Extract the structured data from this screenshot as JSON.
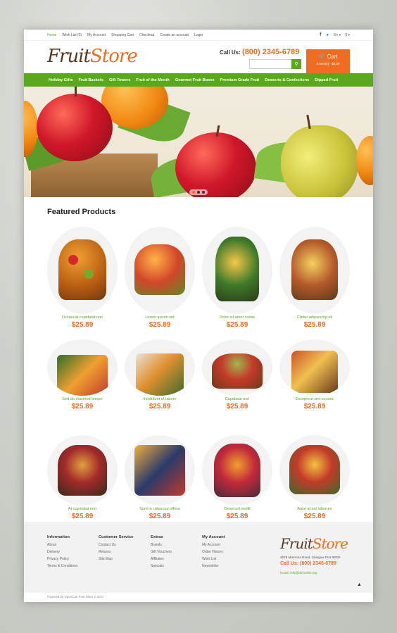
{
  "topbar": {
    "links": [
      "Home",
      "Wish List (0)",
      "My Account",
      "Shopping Cart",
      "Checkout",
      "Create an account",
      "Login"
    ],
    "language": "En",
    "currency": "$"
  },
  "header": {
    "logo_part1": "Fruit",
    "logo_part2": "Store",
    "call_label": "Call Us:",
    "phone": "(800) 2345-6789",
    "cart_label": "Cart",
    "cart_summary": "0 item(s) - $0.00"
  },
  "nav": {
    "items": [
      "Holiday Gifts",
      "Fruit Baskets",
      "Gift Towers",
      "Fruit of the Month",
      "Gourmet Fruit Boxes",
      "Premium Grade Fruit",
      "Desserts & Confections",
      "Dipped Fruit"
    ]
  },
  "featured": {
    "title": "Featured Products",
    "products": [
      {
        "name": "Occaecat cupidatat non",
        "price": "$25.89"
      },
      {
        "name": "Lorem ipsum set",
        "price": "$25.89"
      },
      {
        "name": "Dolor sit amet conse",
        "price": "$25.89"
      },
      {
        "name": "Ctetur adipisicing eli",
        "price": "$25.89"
      },
      {
        "name": "Sed do eiusmod tempo",
        "price": "$25.89"
      },
      {
        "name": "Incididunt ut labore",
        "price": "$25.89"
      },
      {
        "name": "Cupidatat non",
        "price": "$25.89"
      },
      {
        "name": "Excepteur sint occaec",
        "price": "$25.89"
      },
      {
        "name": "At cupidatat non",
        "price": "$25.89"
      },
      {
        "name": "Sunt in culpa qui officia",
        "price": "$25.89"
      },
      {
        "name": "Deserunt mollit",
        "price": "$25.89"
      },
      {
        "name": "Anim id est laborum",
        "price": "$25.89"
      }
    ]
  },
  "footer": {
    "columns": [
      {
        "title": "Information",
        "links": [
          "About",
          "Delivery",
          "Privacy Policy",
          "Terms & Conditions"
        ]
      },
      {
        "title": "Customer Service",
        "links": [
          "Contact Us",
          "Returns",
          "Site Map"
        ]
      },
      {
        "title": "Extras",
        "links": [
          "Brands",
          "Gift Vouchers",
          "Affiliates",
          "Specials"
        ]
      },
      {
        "title": "My Account",
        "links": [
          "My Account",
          "Order History",
          "Wish List",
          "Newsletter"
        ]
      }
    ],
    "logo_part1": "Fruit",
    "logo_part2": "Store",
    "address": "4578 Marmora Road, Glasgow D04 89GR",
    "phone": "Call Us: (800) 2345-6789",
    "email": "Email: info@demolink.org",
    "copyright": "Powered by OpenCart Fruit Store © 2017"
  },
  "colors": {
    "green": "#5aa81c",
    "orange": "#ef6c22",
    "brown": "#5a3a22"
  }
}
